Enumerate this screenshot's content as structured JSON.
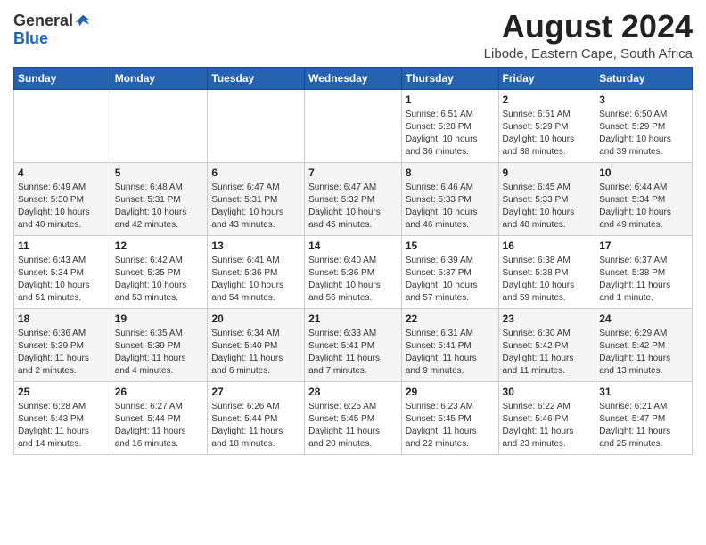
{
  "header": {
    "logo_general": "General",
    "logo_blue": "Blue",
    "month_year": "August 2024",
    "location": "Libode, Eastern Cape, South Africa"
  },
  "calendar": {
    "headers": [
      "Sunday",
      "Monday",
      "Tuesday",
      "Wednesday",
      "Thursday",
      "Friday",
      "Saturday"
    ],
    "weeks": [
      [
        {
          "day": "",
          "info": ""
        },
        {
          "day": "",
          "info": ""
        },
        {
          "day": "",
          "info": ""
        },
        {
          "day": "",
          "info": ""
        },
        {
          "day": "1",
          "info": "Sunrise: 6:51 AM\nSunset: 5:28 PM\nDaylight: 10 hours\nand 36 minutes."
        },
        {
          "day": "2",
          "info": "Sunrise: 6:51 AM\nSunset: 5:29 PM\nDaylight: 10 hours\nand 38 minutes."
        },
        {
          "day": "3",
          "info": "Sunrise: 6:50 AM\nSunset: 5:29 PM\nDaylight: 10 hours\nand 39 minutes."
        }
      ],
      [
        {
          "day": "4",
          "info": "Sunrise: 6:49 AM\nSunset: 5:30 PM\nDaylight: 10 hours\nand 40 minutes."
        },
        {
          "day": "5",
          "info": "Sunrise: 6:48 AM\nSunset: 5:31 PM\nDaylight: 10 hours\nand 42 minutes."
        },
        {
          "day": "6",
          "info": "Sunrise: 6:47 AM\nSunset: 5:31 PM\nDaylight: 10 hours\nand 43 minutes."
        },
        {
          "day": "7",
          "info": "Sunrise: 6:47 AM\nSunset: 5:32 PM\nDaylight: 10 hours\nand 45 minutes."
        },
        {
          "day": "8",
          "info": "Sunrise: 6:46 AM\nSunset: 5:33 PM\nDaylight: 10 hours\nand 46 minutes."
        },
        {
          "day": "9",
          "info": "Sunrise: 6:45 AM\nSunset: 5:33 PM\nDaylight: 10 hours\nand 48 minutes."
        },
        {
          "day": "10",
          "info": "Sunrise: 6:44 AM\nSunset: 5:34 PM\nDaylight: 10 hours\nand 49 minutes."
        }
      ],
      [
        {
          "day": "11",
          "info": "Sunrise: 6:43 AM\nSunset: 5:34 PM\nDaylight: 10 hours\nand 51 minutes."
        },
        {
          "day": "12",
          "info": "Sunrise: 6:42 AM\nSunset: 5:35 PM\nDaylight: 10 hours\nand 53 minutes."
        },
        {
          "day": "13",
          "info": "Sunrise: 6:41 AM\nSunset: 5:36 PM\nDaylight: 10 hours\nand 54 minutes."
        },
        {
          "day": "14",
          "info": "Sunrise: 6:40 AM\nSunset: 5:36 PM\nDaylight: 10 hours\nand 56 minutes."
        },
        {
          "day": "15",
          "info": "Sunrise: 6:39 AM\nSunset: 5:37 PM\nDaylight: 10 hours\nand 57 minutes."
        },
        {
          "day": "16",
          "info": "Sunrise: 6:38 AM\nSunset: 5:38 PM\nDaylight: 10 hours\nand 59 minutes."
        },
        {
          "day": "17",
          "info": "Sunrise: 6:37 AM\nSunset: 5:38 PM\nDaylight: 11 hours\nand 1 minute."
        }
      ],
      [
        {
          "day": "18",
          "info": "Sunrise: 6:36 AM\nSunset: 5:39 PM\nDaylight: 11 hours\nand 2 minutes."
        },
        {
          "day": "19",
          "info": "Sunrise: 6:35 AM\nSunset: 5:39 PM\nDaylight: 11 hours\nand 4 minutes."
        },
        {
          "day": "20",
          "info": "Sunrise: 6:34 AM\nSunset: 5:40 PM\nDaylight: 11 hours\nand 6 minutes."
        },
        {
          "day": "21",
          "info": "Sunrise: 6:33 AM\nSunset: 5:41 PM\nDaylight: 11 hours\nand 7 minutes."
        },
        {
          "day": "22",
          "info": "Sunrise: 6:31 AM\nSunset: 5:41 PM\nDaylight: 11 hours\nand 9 minutes."
        },
        {
          "day": "23",
          "info": "Sunrise: 6:30 AM\nSunset: 5:42 PM\nDaylight: 11 hours\nand 11 minutes."
        },
        {
          "day": "24",
          "info": "Sunrise: 6:29 AM\nSunset: 5:42 PM\nDaylight: 11 hours\nand 13 minutes."
        }
      ],
      [
        {
          "day": "25",
          "info": "Sunrise: 6:28 AM\nSunset: 5:43 PM\nDaylight: 11 hours\nand 14 minutes."
        },
        {
          "day": "26",
          "info": "Sunrise: 6:27 AM\nSunset: 5:44 PM\nDaylight: 11 hours\nand 16 minutes."
        },
        {
          "day": "27",
          "info": "Sunrise: 6:26 AM\nSunset: 5:44 PM\nDaylight: 11 hours\nand 18 minutes."
        },
        {
          "day": "28",
          "info": "Sunrise: 6:25 AM\nSunset: 5:45 PM\nDaylight: 11 hours\nand 20 minutes."
        },
        {
          "day": "29",
          "info": "Sunrise: 6:23 AM\nSunset: 5:45 PM\nDaylight: 11 hours\nand 22 minutes."
        },
        {
          "day": "30",
          "info": "Sunrise: 6:22 AM\nSunset: 5:46 PM\nDaylight: 11 hours\nand 23 minutes."
        },
        {
          "day": "31",
          "info": "Sunrise: 6:21 AM\nSunset: 5:47 PM\nDaylight: 11 hours\nand 25 minutes."
        }
      ]
    ]
  }
}
